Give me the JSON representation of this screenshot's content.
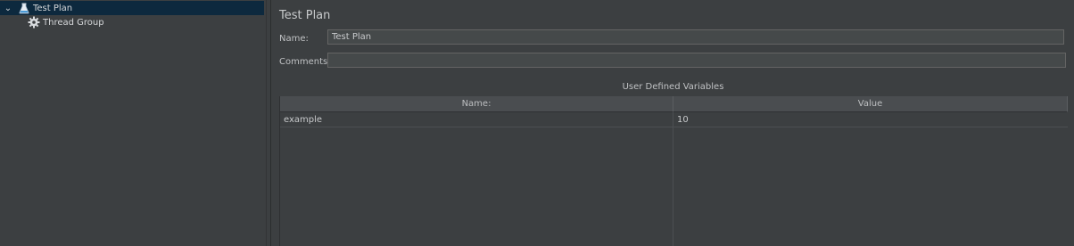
{
  "tree": {
    "items": [
      {
        "label": "Test Plan",
        "icon": "flask-icon",
        "expanded": true,
        "selected": true
      },
      {
        "label": "Thread Group",
        "icon": "gear-icon",
        "selected": false
      }
    ]
  },
  "main": {
    "title": "Test Plan",
    "name_label": "Name:",
    "name_value": "Test Plan",
    "comments_label": "Comments:",
    "comments_value": "",
    "variables": {
      "title": "User Defined Variables",
      "columns": [
        "Name:",
        "Value"
      ],
      "rows": [
        {
          "name": "example",
          "value": "10"
        }
      ]
    }
  },
  "colors": {
    "background": "#3c3f41",
    "selection": "#0d293e",
    "field_bg": "#45494a",
    "accent_icon": "#4a9bd8"
  }
}
